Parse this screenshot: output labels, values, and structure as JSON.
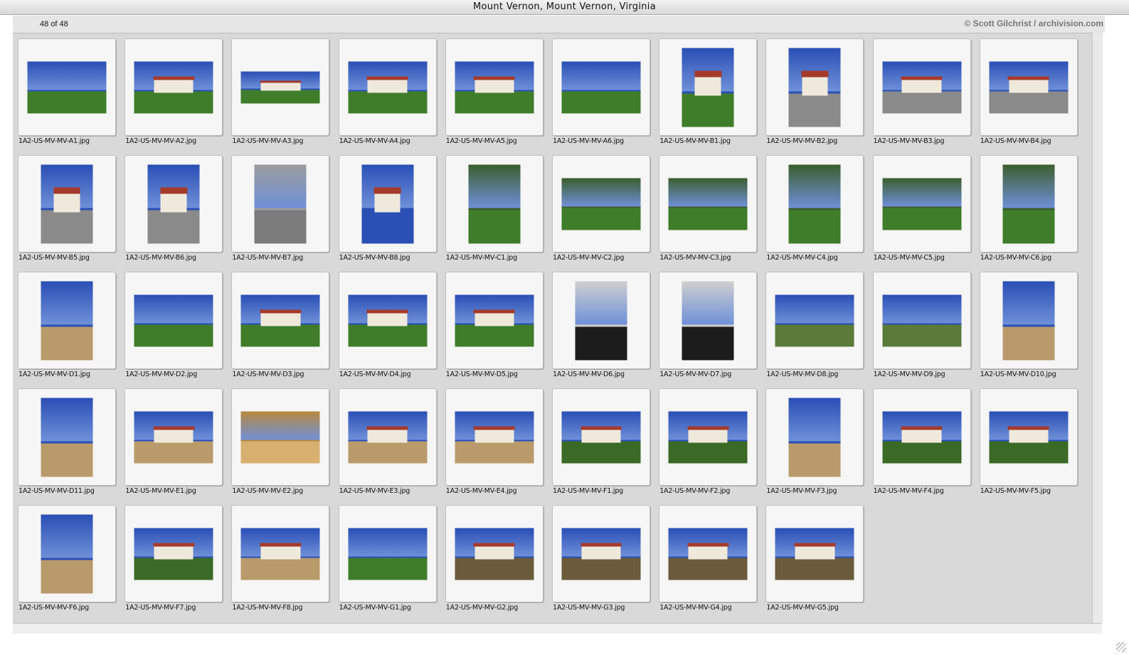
{
  "window": {
    "title": "Mount Vernon, Mount Vernon, Virginia"
  },
  "toolbar": {
    "count": "48 of 48",
    "credit": "© Scott Gilchrist / archivision.com"
  },
  "colors": {
    "sky": "#2a4fb5",
    "grass": "#3f7d2a",
    "path": "#b99a6b",
    "interior": "#b8893f",
    "dark": "#1c1c1c"
  },
  "thumbnails": [
    {
      "file": "1A2-US-MV-MV-A1.jpg",
      "orientation": "land",
      "scene": "lawn"
    },
    {
      "file": "1A2-US-MV-MV-A2.jpg",
      "orientation": "land",
      "scene": "house"
    },
    {
      "file": "1A2-US-MV-MV-A3.jpg",
      "orientation": "wide",
      "scene": "house"
    },
    {
      "file": "1A2-US-MV-MV-A4.jpg",
      "orientation": "land",
      "scene": "house"
    },
    {
      "file": "1A2-US-MV-MV-A5.jpg",
      "orientation": "land",
      "scene": "house"
    },
    {
      "file": "1A2-US-MV-MV-A6.jpg",
      "orientation": "land",
      "scene": "lawn"
    },
    {
      "file": "1A2-US-MV-MV-B1.jpg",
      "orientation": "port",
      "scene": "house"
    },
    {
      "file": "1A2-US-MV-MV-B2.jpg",
      "orientation": "port",
      "scene": "facade"
    },
    {
      "file": "1A2-US-MV-MV-B3.jpg",
      "orientation": "land",
      "scene": "facade"
    },
    {
      "file": "1A2-US-MV-MV-B4.jpg",
      "orientation": "land",
      "scene": "facade"
    },
    {
      "file": "1A2-US-MV-MV-B5.jpg",
      "orientation": "port",
      "scene": "facade"
    },
    {
      "file": "1A2-US-MV-MV-B6.jpg",
      "orientation": "port",
      "scene": "facade"
    },
    {
      "file": "1A2-US-MV-MV-B7.jpg",
      "orientation": "port",
      "scene": "wall"
    },
    {
      "file": "1A2-US-MV-MV-B8.jpg",
      "orientation": "port",
      "scene": "cupola"
    },
    {
      "file": "1A2-US-MV-MV-C1.jpg",
      "orientation": "port",
      "scene": "colonnade"
    },
    {
      "file": "1A2-US-MV-MV-C2.jpg",
      "orientation": "land",
      "scene": "colonnade"
    },
    {
      "file": "1A2-US-MV-MV-C3.jpg",
      "orientation": "land",
      "scene": "colonnade"
    },
    {
      "file": "1A2-US-MV-MV-C4.jpg",
      "orientation": "port",
      "scene": "colonnade"
    },
    {
      "file": "1A2-US-MV-MV-C5.jpg",
      "orientation": "land",
      "scene": "colonnade"
    },
    {
      "file": "1A2-US-MV-MV-C6.jpg",
      "orientation": "port",
      "scene": "colonnade"
    },
    {
      "file": "1A2-US-MV-MV-D1.jpg",
      "orientation": "port",
      "scene": "gate"
    },
    {
      "file": "1A2-US-MV-MV-D2.jpg",
      "orientation": "land",
      "scene": "lawn"
    },
    {
      "file": "1A2-US-MV-MV-D3.jpg",
      "orientation": "land",
      "scene": "house"
    },
    {
      "file": "1A2-US-MV-MV-D4.jpg",
      "orientation": "land",
      "scene": "house"
    },
    {
      "file": "1A2-US-MV-MV-D5.jpg",
      "orientation": "land",
      "scene": "house"
    },
    {
      "file": "1A2-US-MV-MV-D6.jpg",
      "orientation": "port",
      "scene": "piazza"
    },
    {
      "file": "1A2-US-MV-MV-D7.jpg",
      "orientation": "port",
      "scene": "piazza"
    },
    {
      "file": "1A2-US-MV-MV-D8.jpg",
      "orientation": "land",
      "scene": "river"
    },
    {
      "file": "1A2-US-MV-MV-D9.jpg",
      "orientation": "land",
      "scene": "river"
    },
    {
      "file": "1A2-US-MV-MV-D10.jpg",
      "orientation": "port",
      "scene": "path"
    },
    {
      "file": "1A2-US-MV-MV-D11.jpg",
      "orientation": "port",
      "scene": "gate"
    },
    {
      "file": "1A2-US-MV-MV-E1.jpg",
      "orientation": "land",
      "scene": "outbuilding"
    },
    {
      "file": "1A2-US-MV-MV-E2.jpg",
      "orientation": "land",
      "scene": "interior"
    },
    {
      "file": "1A2-US-MV-MV-E3.jpg",
      "orientation": "land",
      "scene": "outbuilding"
    },
    {
      "file": "1A2-US-MV-MV-E4.jpg",
      "orientation": "land",
      "scene": "outbuilding"
    },
    {
      "file": "1A2-US-MV-MV-F1.jpg",
      "orientation": "land",
      "scene": "garden"
    },
    {
      "file": "1A2-US-MV-MV-F2.jpg",
      "orientation": "land",
      "scene": "garden"
    },
    {
      "file": "1A2-US-MV-MV-F3.jpg",
      "orientation": "port",
      "scene": "path"
    },
    {
      "file": "1A2-US-MV-MV-F4.jpg",
      "orientation": "land",
      "scene": "garden"
    },
    {
      "file": "1A2-US-MV-MV-F5.jpg",
      "orientation": "land",
      "scene": "garden"
    },
    {
      "file": "1A2-US-MV-MV-F6.jpg",
      "orientation": "port",
      "scene": "path"
    },
    {
      "file": "1A2-US-MV-MV-F7.jpg",
      "orientation": "land",
      "scene": "garden"
    },
    {
      "file": "1A2-US-MV-MV-F8.jpg",
      "orientation": "land",
      "scene": "greenhouse"
    },
    {
      "file": "1A2-US-MV-MV-G1.jpg",
      "orientation": "land",
      "scene": "lawn"
    },
    {
      "file": "1A2-US-MV-MV-G2.jpg",
      "orientation": "land",
      "scene": "field"
    },
    {
      "file": "1A2-US-MV-MV-G3.jpg",
      "orientation": "land",
      "scene": "field"
    },
    {
      "file": "1A2-US-MV-MV-G4.jpg",
      "orientation": "land",
      "scene": "field"
    },
    {
      "file": "1A2-US-MV-MV-G5.jpg",
      "orientation": "land",
      "scene": "field"
    }
  ]
}
